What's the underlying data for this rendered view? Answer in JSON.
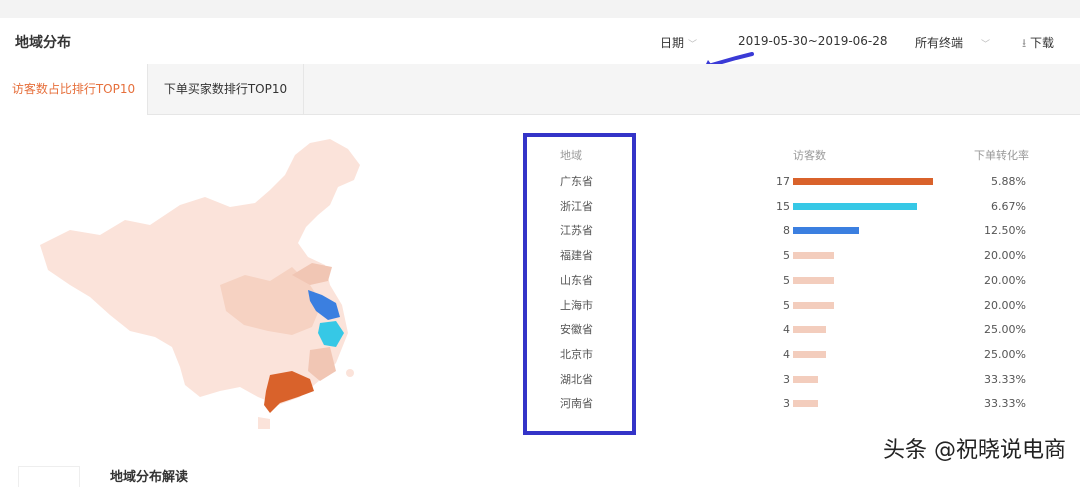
{
  "header": {
    "title": "地域分布",
    "date_label": "日期",
    "date_range": "2019-05-30~2019-06-28",
    "terminal": "所有终端",
    "download": "下载"
  },
  "tabs": [
    {
      "label": "访客数占比排行TOP10",
      "active": true
    },
    {
      "label": "下单买家数排行TOP10",
      "active": false
    }
  ],
  "table": {
    "headers": {
      "region": "地域",
      "visitors": "访客数",
      "conversion": "下单转化率"
    },
    "rows": [
      {
        "region": "广东省",
        "visitors": "17",
        "value": 17,
        "conversion": "5.88%",
        "color": "#d9622b"
      },
      {
        "region": "浙江省",
        "visitors": "15",
        "value": 15,
        "conversion": "6.67%",
        "color": "#36c8e6"
      },
      {
        "region": "江苏省",
        "visitors": "8",
        "value": 8,
        "conversion": "12.50%",
        "color": "#3b7fe0"
      },
      {
        "region": "福建省",
        "visitors": "5",
        "value": 5,
        "conversion": "20.00%",
        "color": "#f3cdbd"
      },
      {
        "region": "山东省",
        "visitors": "5",
        "value": 5,
        "conversion": "20.00%",
        "color": "#f3cdbd"
      },
      {
        "region": "上海市",
        "visitors": "5",
        "value": 5,
        "conversion": "20.00%",
        "color": "#f3cdbd"
      },
      {
        "region": "安徽省",
        "visitors": "4",
        "value": 4,
        "conversion": "25.00%",
        "color": "#f3cdbd"
      },
      {
        "region": "北京市",
        "visitors": "4",
        "value": 4,
        "conversion": "25.00%",
        "color": "#f3cdbd"
      },
      {
        "region": "湖北省",
        "visitors": "3",
        "value": 3,
        "conversion": "33.33%",
        "color": "#f3cdbd"
      },
      {
        "region": "河南省",
        "visitors": "3",
        "value": 3,
        "conversion": "33.33%",
        "color": "#f3cdbd"
      }
    ]
  },
  "footer": {
    "title": "地域分布解读"
  },
  "watermark": "头条 @祝晓说电商",
  "colors": {
    "accent": "#e66f3b",
    "highlight": "#3434c8"
  }
}
